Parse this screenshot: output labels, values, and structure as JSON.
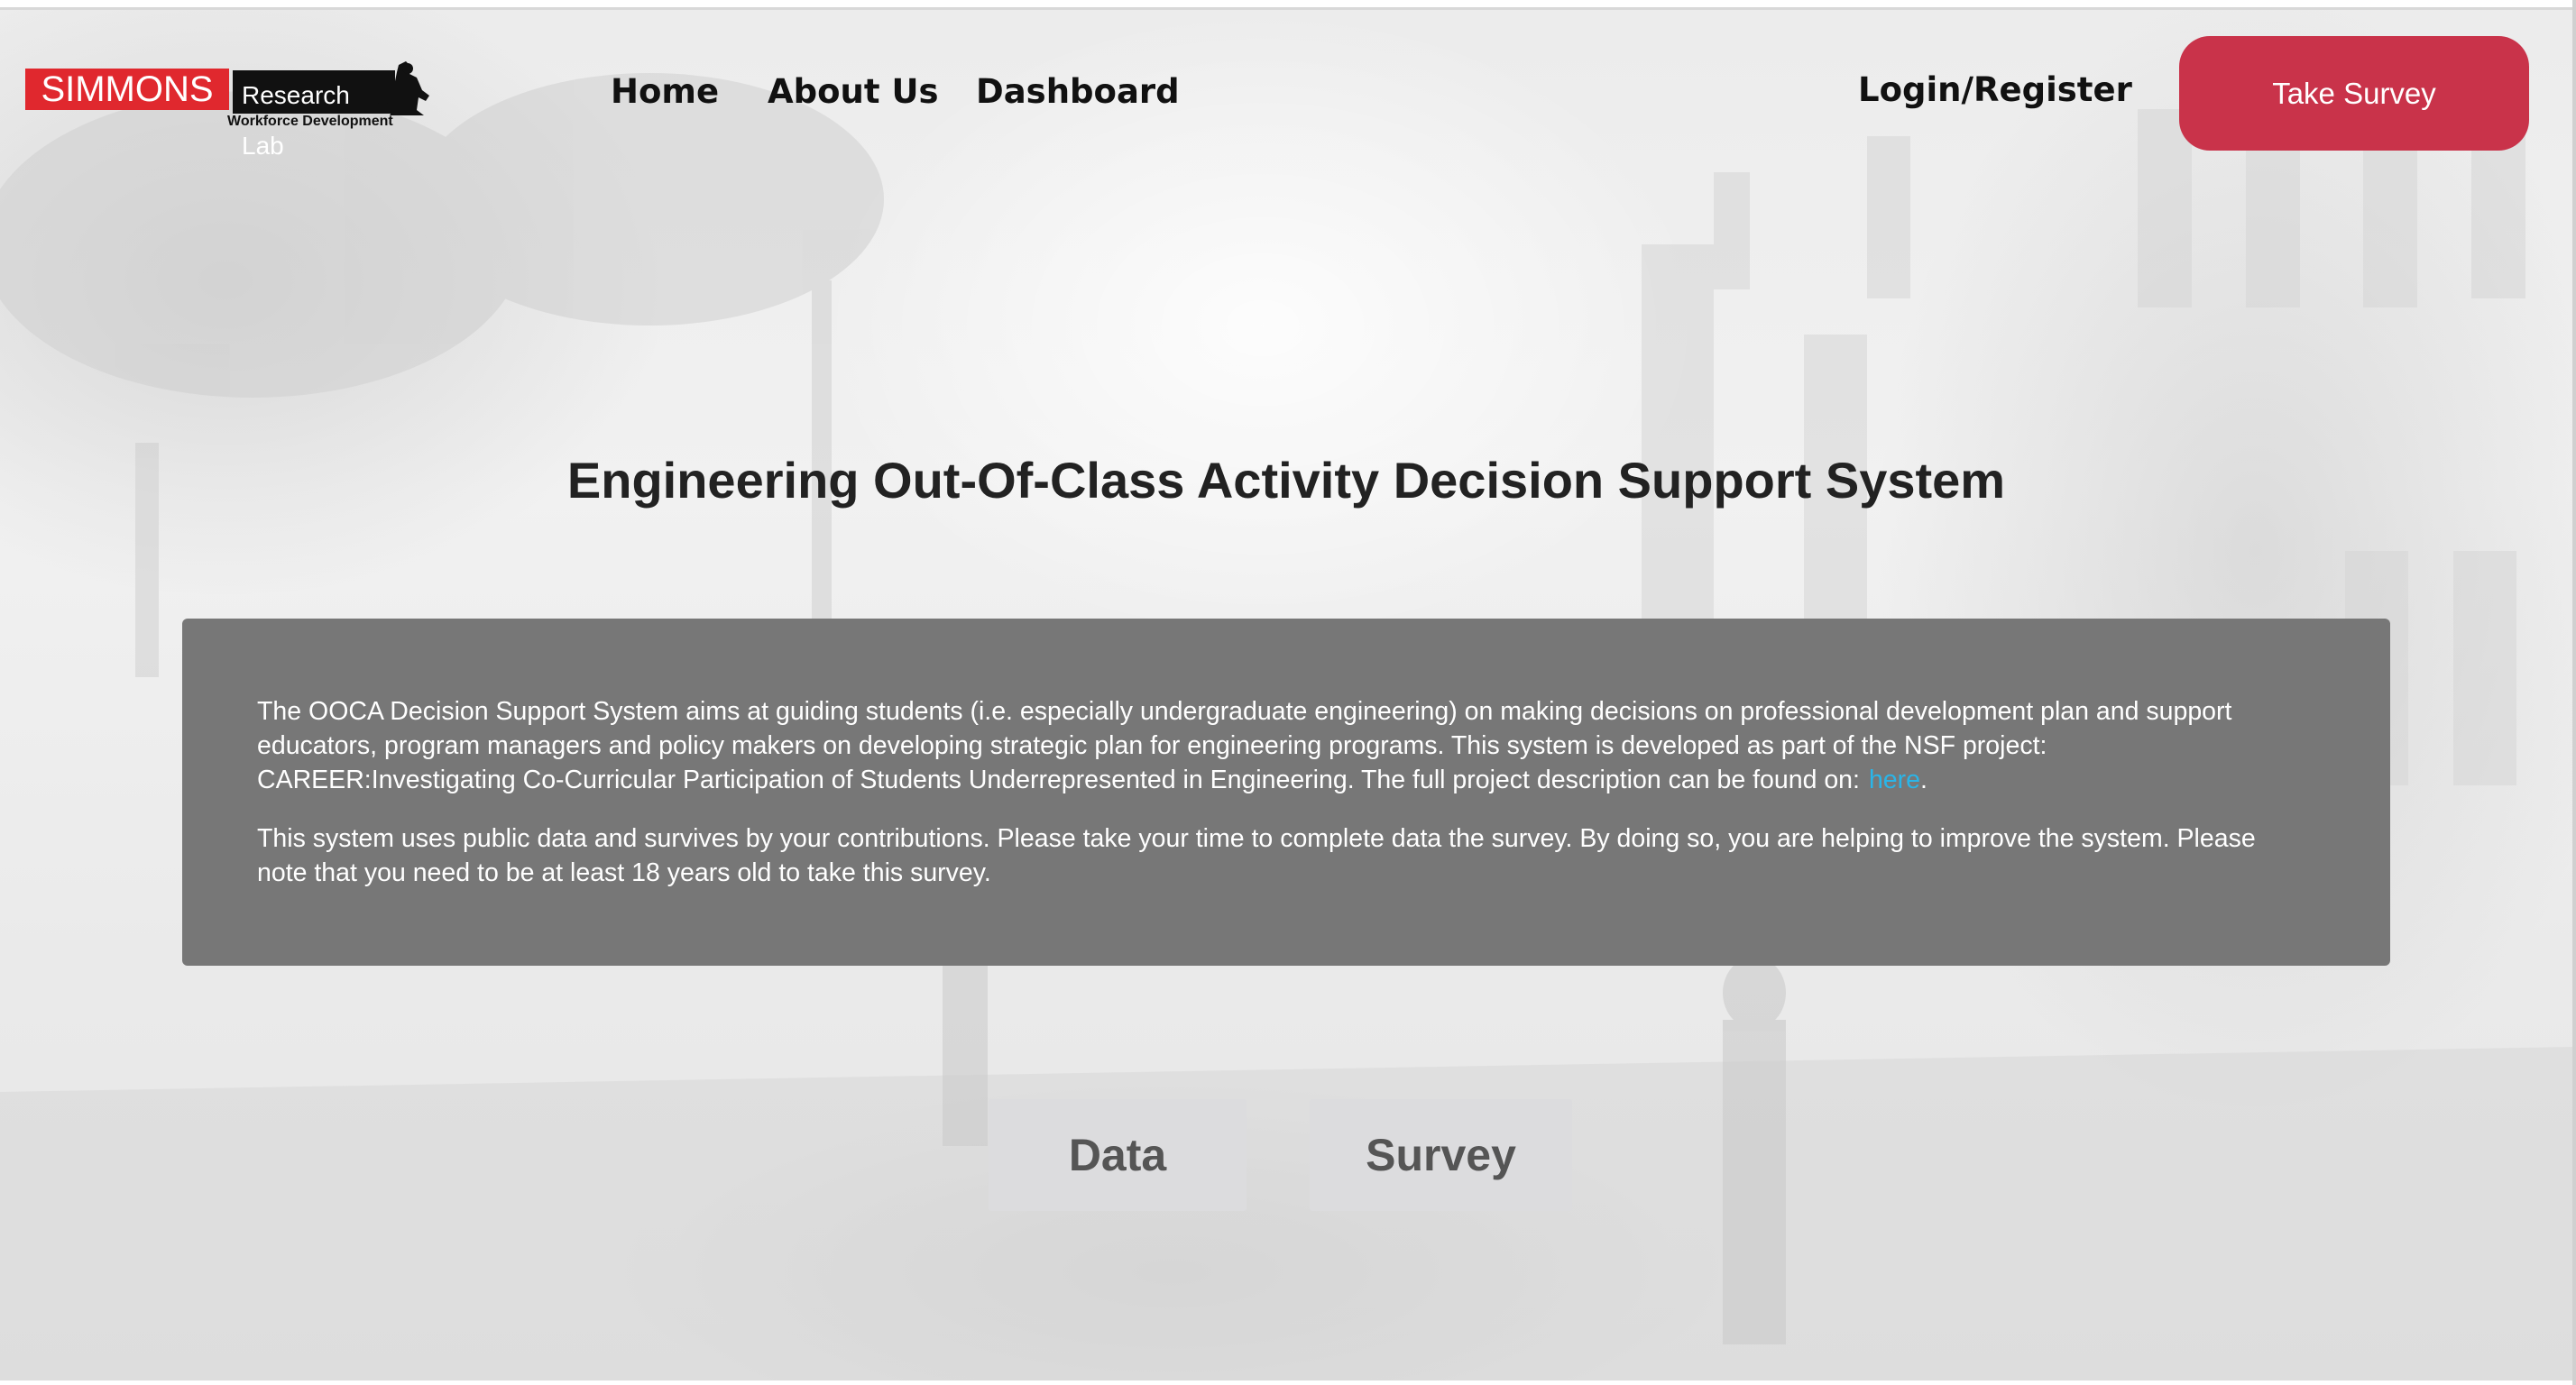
{
  "logo": {
    "brand": "SIMMONS",
    "lab": "Research Lab",
    "subtitle": "Workforce Development"
  },
  "nav": {
    "home": "Home",
    "about": "About Us",
    "dashboard": "Dashboard",
    "login": "Login/Register",
    "take_survey": "Take Survey"
  },
  "main": {
    "title": "Engineering Out-Of-Class Activity Decision Support System",
    "paragraph1": "The OOCA Decision Support System aims at guiding students (i.e. especially undergraduate engineering) on making decisions on professional development plan and support educators, program managers and policy makers on developing strategic plan for engineering programs. This system is developed as part of the NSF project: CAREER:Investigating Co-Curricular Participation of Students Underrepresented in Engineering. The full project description can be found on:",
    "link_text": "here",
    "paragraph1_end": ".",
    "paragraph2": "This system uses public data and survives by your contributions. Please take your time to complete data the survey. By doing so, you are helping to improve the system. Please note that you need to be at least 18 years old to take this survey."
  },
  "buttons": {
    "data": "Data",
    "survey": "Survey"
  },
  "colors": {
    "brand_red": "#e0282e",
    "take_survey_bg": "#c9334a",
    "panel_bg": "#777777",
    "link": "#2ab5e8",
    "button_bg": "#dcdcde"
  },
  "icons": {
    "logo_figure": "mascot-silhouette-icon"
  }
}
